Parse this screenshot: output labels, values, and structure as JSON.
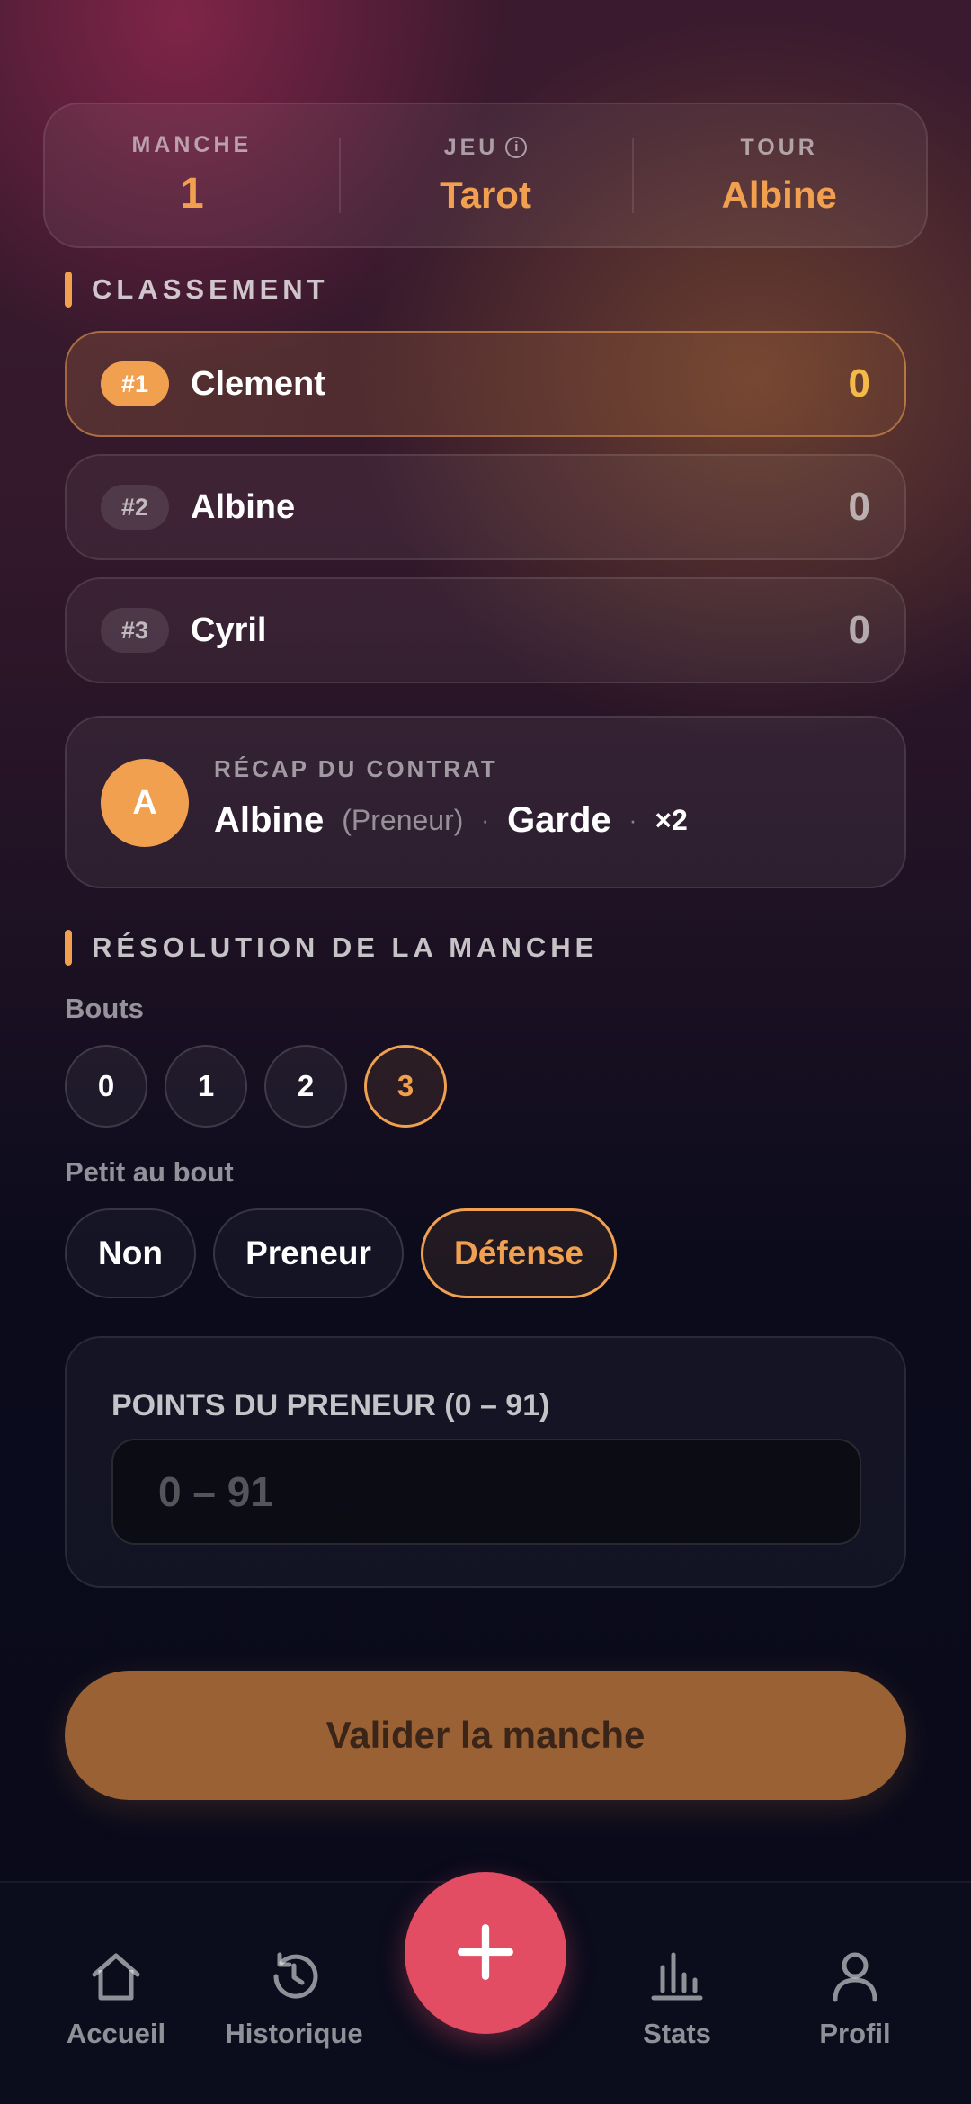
{
  "header": {
    "manche_label": "MANCHE",
    "manche_value": "1",
    "jeu_label": "JEU",
    "jeu_value": "Tarot",
    "tour_label": "TOUR",
    "tour_value": "Albine",
    "info_icon": "info-icon"
  },
  "classement": {
    "title": "CLASSEMENT",
    "rows": [
      {
        "rank": "#1",
        "name": "Clement",
        "score": "0"
      },
      {
        "rank": "#2",
        "name": "Albine",
        "score": "0"
      },
      {
        "rank": "#3",
        "name": "Cyril",
        "score": "0"
      }
    ]
  },
  "recap": {
    "label": "RÉCAP DU CONTRAT",
    "avatar_letter": "A",
    "player": "Albine",
    "role": "(Preneur)",
    "separator": "·",
    "contract": "Garde",
    "multiplier": "×2"
  },
  "resolution": {
    "title": "RÉSOLUTION DE LA MANCHE",
    "bouts_label": "Bouts",
    "bouts": [
      "0",
      "1",
      "2",
      "3"
    ],
    "bouts_selected": "3",
    "petit_label": "Petit au bout",
    "petit_options": [
      "Non",
      "Preneur",
      "Défense"
    ],
    "petit_selected": "Défense",
    "points_label": "POINTS DU PRENEUR (0 – 91)",
    "points_placeholder": "0 – 91",
    "points_value": ""
  },
  "submit_label": "Valider la manche",
  "nav": {
    "items": [
      {
        "label": "Accueil",
        "icon": "home-icon"
      },
      {
        "label": "Historique",
        "icon": "history-icon"
      },
      {
        "label": "Stats",
        "icon": "bar-chart-icon"
      },
      {
        "label": "Profil",
        "icon": "user-icon"
      }
    ],
    "fab_icon": "plus-icon"
  },
  "colors": {
    "accent": "#f0a04f",
    "fab": "#e24d64",
    "score_top": "#f5b94a",
    "submit": "#9a6135"
  }
}
